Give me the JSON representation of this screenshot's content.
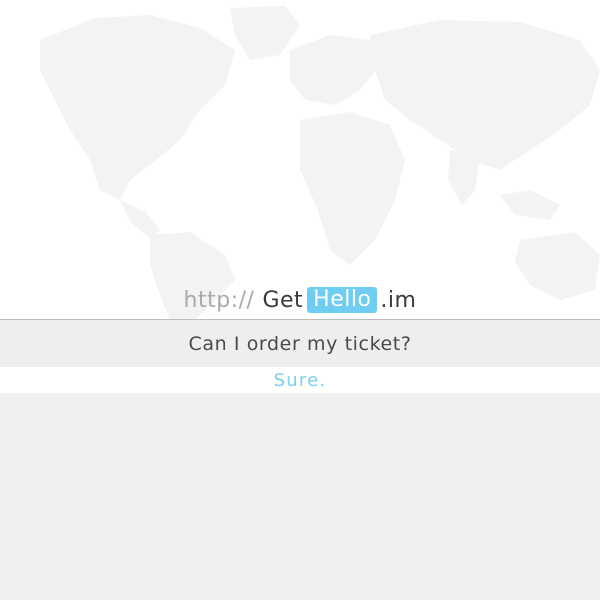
{
  "logo": {
    "prefix": "http://",
    "get": "Get",
    "hello": "Hello",
    "tld": ".im"
  },
  "chat": {
    "question": "Can I order my ticket?",
    "answer": "Sure."
  },
  "colors": {
    "accent": "#6fcdf1",
    "answer_text": "#7ccfee",
    "question_bar": "#eeeeee",
    "background": "#f0f0f0"
  },
  "icons": {
    "background": "world-map-icon"
  }
}
